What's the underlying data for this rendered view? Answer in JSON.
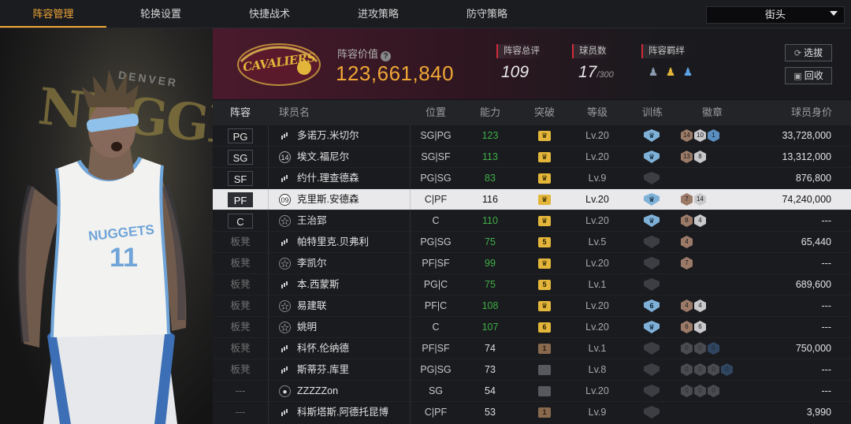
{
  "tabs": [
    {
      "label": "阵容管理",
      "active": true
    },
    {
      "label": "轮换设置",
      "active": false
    },
    {
      "label": "快捷战术",
      "active": false
    },
    {
      "label": "进攻策略",
      "active": false
    },
    {
      "label": "防守策略",
      "active": false
    }
  ],
  "mode_select": {
    "value": "街头"
  },
  "portrait": {
    "jersey_team": "NUGGETS",
    "jersey_number": "11",
    "backdrop_text": "NUGGETS",
    "backdrop_text2": "DENVER"
  },
  "team": {
    "logo_text": "CAVALIERS",
    "value_label": "阵容价值",
    "value": "123,661,840",
    "overall_label": "阵容总评",
    "overall": "109",
    "count_label": "球员数",
    "count": "17",
    "count_max": "/300",
    "bond_label": "阵容羁绊",
    "bond_colors": [
      "#8a9bb0",
      "#e3b53a",
      "#5ea4e8"
    ],
    "buttons": {
      "select": "选拔",
      "recycle": "回收"
    }
  },
  "headers": [
    "阵容",
    "球员名",
    "位置",
    "能力",
    "突破",
    "等级",
    "训练",
    "徽章",
    "球员身价"
  ],
  "rows": [
    {
      "slot": "PG",
      "rank_icon": "bars",
      "rank_text": "",
      "name": "多诺万.米切尔",
      "pos": "SG|PG",
      "ability": "123",
      "ability_color": "g",
      "breakthrough": "crown",
      "level": "Lv.20",
      "train": "blue",
      "train_num": "",
      "badges": [
        [
          "br",
          "14"
        ],
        [
          "sv",
          "10"
        ],
        [
          "bl",
          "1"
        ]
      ],
      "price": "33,728,000"
    },
    {
      "slot": "SG",
      "rank_icon": "num",
      "rank_text": "14",
      "name": "埃文.福尼尔",
      "pos": "SG|SF",
      "ability": "113",
      "ability_color": "g",
      "breakthrough": "crown",
      "level": "Lv.20",
      "train": "blue",
      "train_num": "",
      "badges": [
        [
          "br",
          "13"
        ],
        [
          "sv",
          "8"
        ]
      ],
      "price": "13,312,000"
    },
    {
      "slot": "SF",
      "rank_icon": "bars",
      "rank_text": "",
      "name": "约什.理查德森",
      "pos": "PG|SG",
      "ability": "83",
      "ability_color": "g",
      "breakthrough": "crown",
      "level": "Lv.9",
      "train": "grey",
      "train_num": "",
      "badges": [],
      "price": "876,800"
    },
    {
      "slot": "PF",
      "rank_icon": "num",
      "rank_text": "09",
      "name": "克里斯.安德森",
      "pos": "C|PF",
      "ability": "116",
      "ability_color": "w",
      "breakthrough": "crown",
      "level": "Lv.20",
      "train": "blue",
      "train_num": "",
      "badges": [
        [
          "br",
          "7"
        ],
        [
          "sv",
          "14"
        ]
      ],
      "price": "74,240,000",
      "selected": true
    },
    {
      "slot": "C",
      "rank_icon": "star",
      "rank_text": "",
      "name": "王治郅",
      "pos": "C",
      "ability": "110",
      "ability_color": "g",
      "breakthrough": "crown",
      "level": "Lv.20",
      "train": "blue",
      "train_num": "",
      "badges": [
        [
          "br",
          "8"
        ],
        [
          "sv",
          "4"
        ]
      ],
      "price": "---"
    },
    {
      "slot": "板凳",
      "rank_icon": "bars",
      "rank_text": "",
      "name": "帕特里克.贝弗利",
      "pos": "PG|SG",
      "ability": "75",
      "ability_color": "g",
      "breakthrough": "5",
      "level": "Lv.5",
      "train": "grey",
      "train_num": "",
      "badges": [
        [
          "br",
          "4"
        ]
      ],
      "price": "65,440"
    },
    {
      "slot": "板凳",
      "rank_icon": "star",
      "rank_text": "",
      "name": "李凯尔",
      "pos": "PF|SF",
      "ability": "99",
      "ability_color": "g",
      "breakthrough": "crown",
      "level": "Lv.20",
      "train": "grey",
      "train_num": "",
      "badges": [
        [
          "br",
          "7"
        ]
      ],
      "price": "---"
    },
    {
      "slot": "板凳",
      "rank_icon": "bars",
      "rank_text": "",
      "name": "本.西蒙斯",
      "pos": "PG|C",
      "ability": "75",
      "ability_color": "g",
      "breakthrough": "5",
      "level": "Lv.1",
      "train": "grey",
      "train_num": "",
      "badges": [],
      "price": "689,600"
    },
    {
      "slot": "板凳",
      "rank_icon": "star",
      "rank_text": "",
      "name": "易建联",
      "pos": "PF|C",
      "ability": "108",
      "ability_color": "g",
      "breakthrough": "crown",
      "level": "Lv.20",
      "train": "blue",
      "train_num": "6",
      "badges": [
        [
          "br",
          "4"
        ],
        [
          "sv",
          "4"
        ]
      ],
      "price": "---"
    },
    {
      "slot": "板凳",
      "rank_icon": "star",
      "rank_text": "",
      "name": "姚明",
      "pos": "C",
      "ability": "107",
      "ability_color": "g",
      "breakthrough": "6",
      "level": "Lv.20",
      "train": "blue",
      "train_num": "",
      "badges": [
        [
          "br",
          "6"
        ],
        [
          "sv",
          "6"
        ]
      ],
      "price": "---"
    },
    {
      "slot": "板凳",
      "rank_icon": "bars",
      "rank_text": "",
      "name": "科怀.伦纳德",
      "pos": "PF|SF",
      "ability": "74",
      "ability_color": "w",
      "breakthrough": "bronze1",
      "level": "Lv.1",
      "train": "grey",
      "train_num": "",
      "badges": [
        [
          "dk",
          "0"
        ],
        [
          "dk",
          "0"
        ],
        [
          "db",
          "0"
        ]
      ],
      "price": "750,000"
    },
    {
      "slot": "板凳",
      "rank_icon": "bars",
      "rank_text": "",
      "name": "斯蒂芬.库里",
      "pos": "PG|SG",
      "ability": "73",
      "ability_color": "w",
      "breakthrough": "grey",
      "level": "Lv.8",
      "train": "grey",
      "train_num": "",
      "badges": [
        [
          "dk",
          "0"
        ],
        [
          "dk",
          "0"
        ],
        [
          "dk",
          "0"
        ],
        [
          "db",
          "0"
        ]
      ],
      "price": "---"
    },
    {
      "slot": "---",
      "rank_icon": "user",
      "rank_text": "",
      "name": "ZZZZZon",
      "pos": "SG",
      "ability": "54",
      "ability_color": "w",
      "breakthrough": "grey",
      "level": "Lv.20",
      "train": "grey",
      "train_num": "",
      "badges": [
        [
          "dk",
          "0"
        ],
        [
          "dk",
          "0"
        ],
        [
          "dk",
          "0"
        ]
      ],
      "price": "---"
    },
    {
      "slot": "---",
      "rank_icon": "bars",
      "rank_text": "",
      "name": "科斯塔斯.阿德托昆博",
      "pos": "C|PF",
      "ability": "53",
      "ability_color": "w",
      "breakthrough": "bronze1",
      "level": "Lv.9",
      "train": "grey",
      "train_num": "",
      "badges": [],
      "price": "3,990"
    }
  ]
}
